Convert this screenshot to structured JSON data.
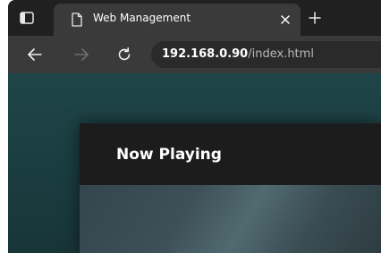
{
  "browser": {
    "tab": {
      "title": "Web Management",
      "favicon": "page-icon"
    },
    "address": {
      "host": "192.168.0.90",
      "path": "/index.html"
    },
    "icons": {
      "tab_actions": "tab-actions-icon",
      "close_tab": "close-icon",
      "new_tab": "plus-icon",
      "back": "back-arrow-icon",
      "forward": "forward-arrow-icon",
      "refresh": "refresh-icon"
    }
  },
  "page": {
    "card": {
      "title": "Now Playing"
    }
  },
  "colors": {
    "tabstrip": "#202020",
    "toolbar": "#3a3a3a",
    "page_background": "#1f4548",
    "card_background": "#1c1c1c"
  }
}
